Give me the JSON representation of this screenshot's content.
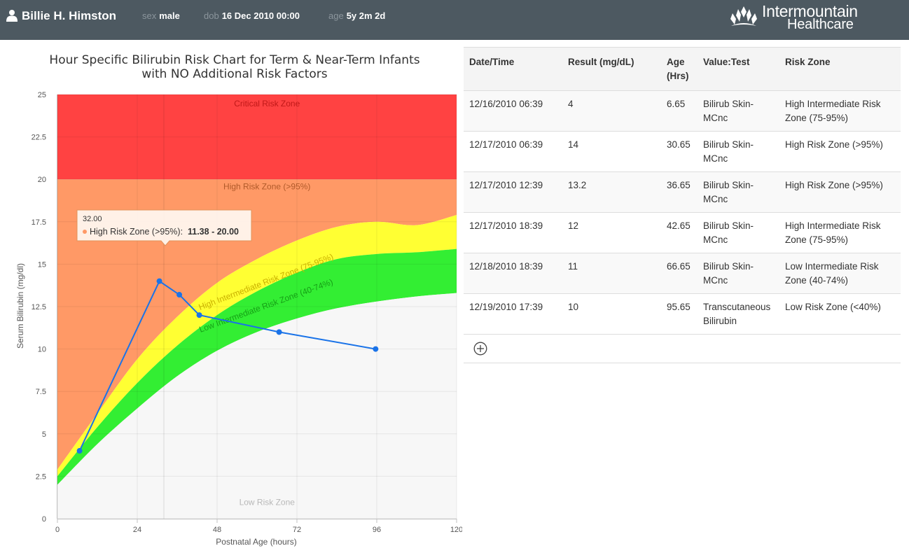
{
  "header": {
    "patient_name": "Billie H. Himston",
    "sex_label": "sex",
    "sex_value": "male",
    "dob_label": "dob",
    "dob_value": "16 Dec 2010 00:00",
    "age_label": "age",
    "age_value": "5y 2m 2d",
    "brand_line1": "Intermountain",
    "brand_line2": "Healthcare"
  },
  "chart_data": {
    "type": "area",
    "title": "Hour Specific Bilirubin Risk Chart for Term & Near-Term Infants",
    "subtitle": "with NO Additional Risk Factors",
    "xlabel": "Postnatal Age (hours)",
    "ylabel": "Serum Bilirubin (mg/dl)",
    "xlim": [
      0,
      120
    ],
    "ylim": [
      0,
      25
    ],
    "x_ticks": [
      "0",
      "24",
      "48",
      "72",
      "96",
      "120"
    ],
    "y_ticks": [
      "0",
      "2.5",
      "5",
      "7.5",
      "10",
      "12.5",
      "15",
      "17.5",
      "20",
      "22.5",
      "25"
    ],
    "grid": true,
    "zones": [
      {
        "name": "Critical Risk Zone",
        "color": "#ff4242",
        "label_at": [
          63,
          24.3
        ]
      },
      {
        "name": "High Risk Zone (>95%)",
        "color": "#ff9966",
        "label_at": [
          63,
          19.4
        ]
      },
      {
        "name": "High Intermediate Risk Zone (75-95%)",
        "color": "#ffff33",
        "label_at": [
          63,
          13.8
        ],
        "label_angle": -21
      },
      {
        "name": "Low Intermediate Risk Zone (40-74%)",
        "color": "#33ee33",
        "label_at": [
          63,
          12.4
        ],
        "label_angle": -20
      },
      {
        "name": "Low Risk Zone",
        "color": "#f7f7f7",
        "label_at": [
          63,
          0.8
        ]
      }
    ],
    "boundaries": {
      "x": [
        0,
        12,
        24,
        36,
        48,
        60,
        72,
        84,
        96,
        108,
        120
      ],
      "p95": [
        2.9,
        6.2,
        9.4,
        11.9,
        13.9,
        15.3,
        16.4,
        17.2,
        17.5,
        17.3,
        17.9
      ],
      "p75": [
        2.5,
        5.4,
        8.0,
        10.2,
        12.0,
        13.4,
        14.5,
        15.3,
        15.6,
        15.7,
        15.9
      ],
      "p40": [
        2.0,
        4.4,
        6.5,
        8.4,
        9.9,
        11.0,
        11.8,
        12.4,
        12.8,
        13.1,
        13.3
      ]
    },
    "critical_threshold": 20,
    "series": [
      {
        "color": "#1a73e8",
        "x": [
          6.65,
          30.65,
          36.65,
          42.65,
          66.65,
          95.65
        ],
        "y": [
          4,
          14,
          13.2,
          12,
          11,
          10
        ]
      }
    ],
    "crosshair_x": 32,
    "tooltip": {
      "header": "32.00",
      "series_label": "High Risk Zone (>95%):",
      "range_value": "11.38 - 20.00"
    }
  },
  "table": {
    "headers": [
      "Date/Time",
      "Result (mg/dL)",
      "Age (Hrs)",
      "Value:Test",
      "Risk Zone"
    ],
    "rows": [
      [
        "12/16/2010 06:39",
        "4",
        "6.65",
        "Bilirub Skin-MCnc",
        "High Intermediate Risk Zone (75-95%)"
      ],
      [
        "12/17/2010 06:39",
        "14",
        "30.65",
        "Bilirub Skin-MCnc",
        "High Risk Zone (>95%)"
      ],
      [
        "12/17/2010 12:39",
        "13.2",
        "36.65",
        "Bilirub Skin-MCnc",
        "High Risk Zone (>95%)"
      ],
      [
        "12/17/2010 18:39",
        "12",
        "42.65",
        "Bilirub Skin-MCnc",
        "High Intermediate Risk Zone (75-95%)"
      ],
      [
        "12/18/2010 18:39",
        "11",
        "66.65",
        "Bilirub Skin-MCnc",
        "Low Intermediate Risk Zone (40-74%)"
      ],
      [
        "12/19/2010 17:39",
        "10",
        "95.65",
        "Transcutaneous Bilirubin",
        "Low Risk Zone (<40%)"
      ]
    ]
  },
  "icons": {
    "user": "user-icon",
    "logo": "intermountain-logo-icon",
    "add": "add-circle-icon"
  }
}
